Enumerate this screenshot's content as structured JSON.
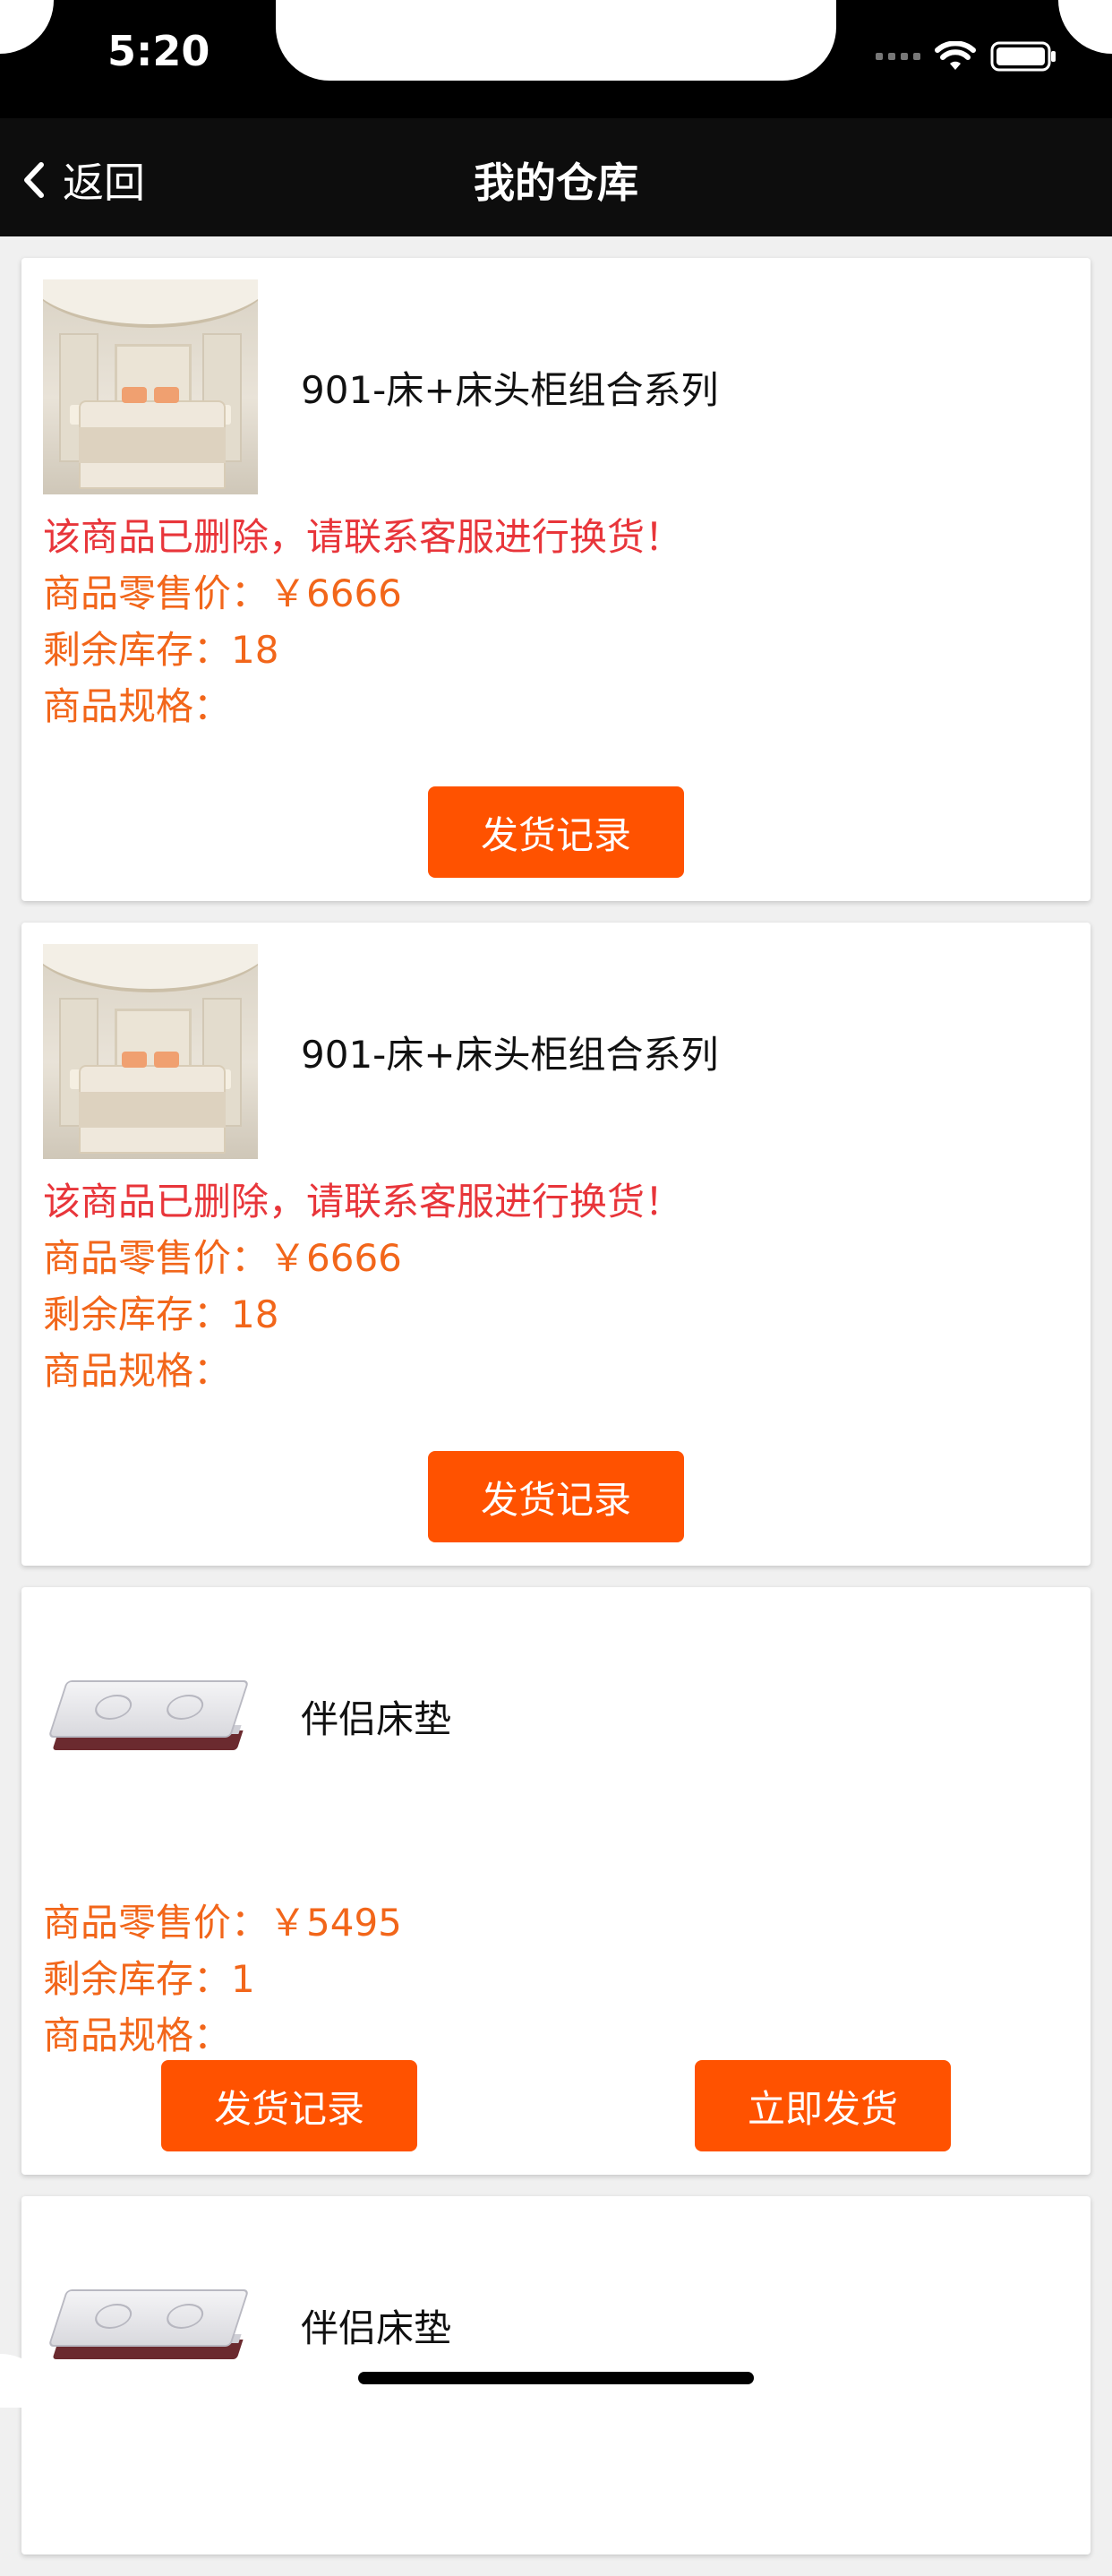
{
  "status_bar": {
    "time": "5:20"
  },
  "nav": {
    "back_label": "返回",
    "title": "我的仓库"
  },
  "labels": {
    "retail_price_prefix": "商品零售价：",
    "stock_prefix": "剩余库存：",
    "spec_prefix": "商品规格："
  },
  "products": [
    {
      "name": "901-床+床头柜组合系列",
      "image_icon": "bed-room-thumbnail",
      "warning": "该商品已删除，请联系客服进行换货！",
      "price": "￥6666",
      "stock": "18",
      "spec": "",
      "buttons": [
        "发货记录"
      ]
    },
    {
      "name": "901-床+床头柜组合系列",
      "image_icon": "bed-room-thumbnail",
      "warning": "该商品已删除，请联系客服进行换货！",
      "price": "￥6666",
      "stock": "18",
      "spec": "",
      "buttons": [
        "发货记录"
      ]
    },
    {
      "name": "伴侣床垫",
      "image_icon": "mattress-thumbnail",
      "warning": "",
      "price": "￥5495",
      "stock": "1",
      "spec": "",
      "buttons": [
        "发货记录",
        "立即发货"
      ]
    },
    {
      "name": "伴侣床垫",
      "image_icon": "mattress-thumbnail"
    }
  ],
  "colors": {
    "accent": "#ff5200",
    "warning_text": "#e8353a",
    "info_text": "#f2661a",
    "nav_bg": "#0d0d0d"
  }
}
